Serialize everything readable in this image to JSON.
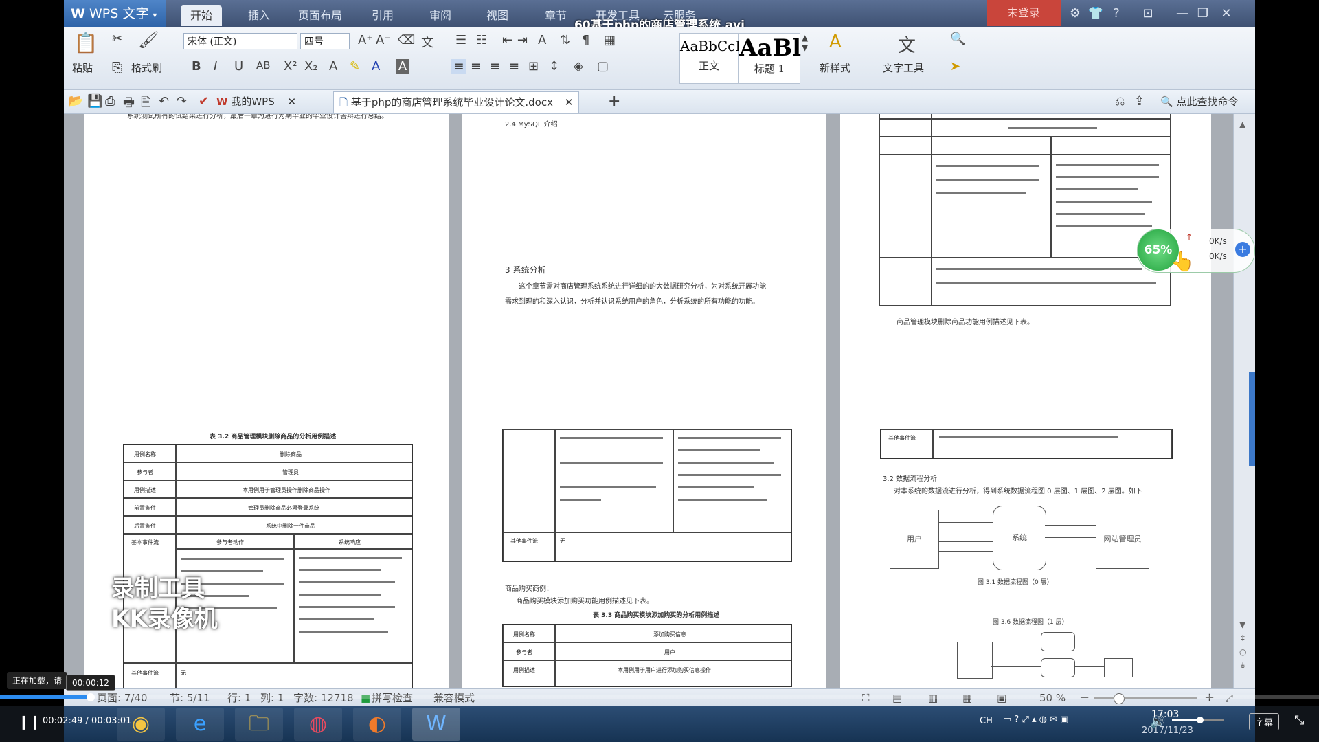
{
  "window": {
    "app_name": "WPS 文字",
    "video_title": "60基于php的商店管理系统.avi",
    "login_label": "未登录"
  },
  "menu_tabs": [
    "开始",
    "插入",
    "页面布局",
    "引用",
    "审阅",
    "视图",
    "章节",
    "开发工具",
    "云服务"
  ],
  "ribbon": {
    "paste": "粘贴",
    "format_painter": "格式刷",
    "font_name": "宋体 (正文)",
    "font_size": "四号",
    "style_normal_preview": "AaBbCcI",
    "style_normal_label": "正文",
    "style_heading_preview": "AaBl",
    "style_heading_label": "标题 1",
    "new_style": "新样式",
    "text_tools": "文字工具"
  },
  "quickbar": {
    "tab_mywps": "我的WPS",
    "tab_doc": "基于php的商店管理系统毕业设计论文.docx",
    "find_command": "点此查找命令"
  },
  "pages": {
    "p1_text": "系统测试所有的试结果进行分析，最后一章为进行为期毕业的毕业设计答辩进行总结。",
    "p2_heading_24": "2.4 MySQL 介绍",
    "p2_heading_3": "3 系统分析",
    "p2_para1": "这个章节需对商店管理系统系统进行详细的的大数据研究分析，为对系统开展功能",
    "p2_para2": "需求到理的和深入认识，分析并认识系统用户的角色，分析系统的所有功能的功能。",
    "p3_caption": "商品管理模块删除商品功能用例描述见下表。",
    "p4_table_title": "表 3.2 商品管理模块删除商品的分析用例描述",
    "p4_rows": [
      "用例名称",
      "参与者",
      "用例描述",
      "前置条件",
      "后置条件",
      "基本事件流"
    ],
    "p4_values": [
      "删除商品",
      "管理员",
      "本用例用于管理员操作删除商品操作",
      "管理员删除商品必须登录系统",
      "系统中删除一件商品"
    ],
    "p4_actor_col": "参与者动作",
    "p4_system_col": "系统响应",
    "p4_other": "其他事件流",
    "p4_other_val": "无",
    "p5_section": "商品购买商例：",
    "p5_line": "商品购买模块添加购买功能用例描述见下表。",
    "p5_table_title": "表 3.3 商品购买模块添加购买的分析用例描述",
    "p5_rows": [
      "用例名称",
      "参与者",
      "用例描述"
    ],
    "p5_values": [
      "添加购买信息",
      "用户",
      "本用例用于用户进行添加购买信息操作"
    ],
    "p6_section": "3.2 数据流程分析",
    "p6_para": "对本系统的数据流进行分析，得到系统数据流程图 0 层图、1 层图、2 层图。如下",
    "p6_user": "用户",
    "p6_system": "系统",
    "p6_admin": "网站管理员",
    "p6_fig1": "图 3.1 数据流程图（0 层）",
    "p6_fig2": "图 3.6 数据流程图（1 层）"
  },
  "status": {
    "page": "页面: 7/40",
    "section": "节: 5/11",
    "row": "行: 1",
    "col": "列: 1",
    "words": "字数: 12718",
    "spell": "拼写检查",
    "mode": "兼容模式",
    "zoom": "50 %"
  },
  "overlays": {
    "speed_percent": "65%",
    "up_speed": "0K/s",
    "down_speed": "0K/s",
    "watermark_line1": "录制工具",
    "watermark_line2": "KK录像机",
    "loading_text": "正在加载，请",
    "hover_time": "00:00:12"
  },
  "player": {
    "current": "00:02:49",
    "total": "00:03:01",
    "progress": 0.069,
    "subtitle_btn": "字幕"
  },
  "taskbar": {
    "clock_time": "17:03",
    "clock_date": "2017/11/23",
    "ime": "CH"
  }
}
